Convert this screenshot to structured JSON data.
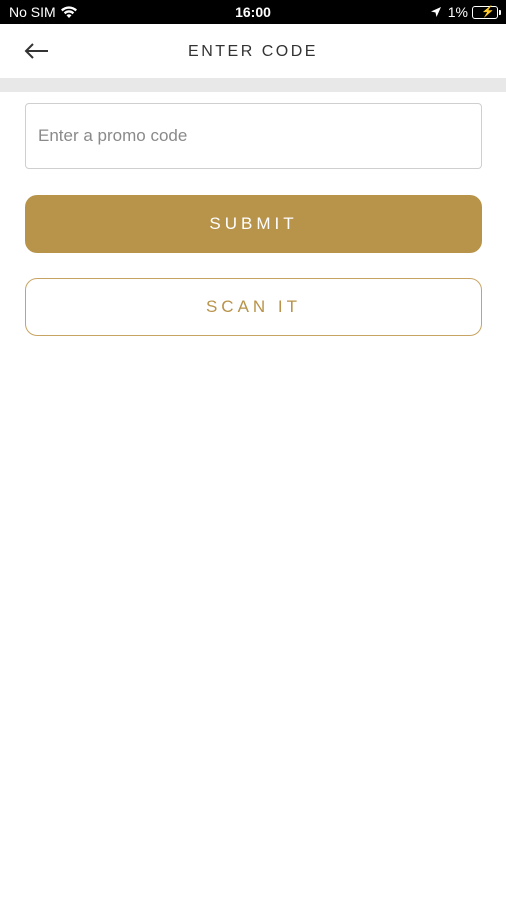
{
  "status_bar": {
    "carrier": "No SIM",
    "time": "16:00",
    "battery": "1%"
  },
  "header": {
    "title": "ENTER CODE"
  },
  "promo": {
    "placeholder": "Enter a promo code",
    "value": ""
  },
  "actions": {
    "submit_label": "SUBMIT",
    "scan_label": "SCAN IT"
  },
  "colors": {
    "accent": "#b8934a",
    "outline_accent": "#c8a464",
    "divider": "#e8e8e8"
  }
}
